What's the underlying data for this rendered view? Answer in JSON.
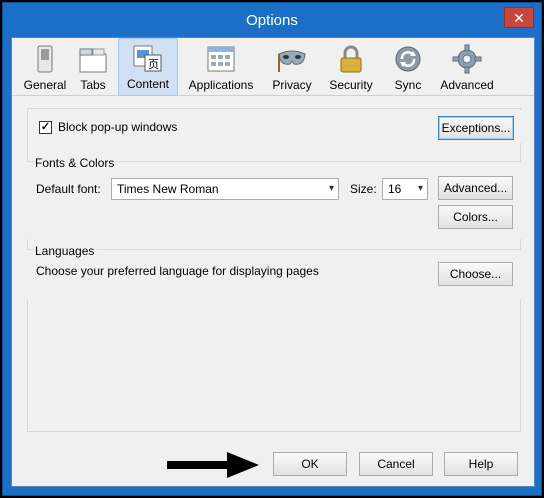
{
  "window": {
    "title": "Options",
    "close_glyph": "✕"
  },
  "toolbar": {
    "items": [
      {
        "label": "General",
        "icon": "switch-icon"
      },
      {
        "label": "Tabs",
        "icon": "tabs-icon"
      },
      {
        "label": "Content",
        "icon": "content-icon",
        "active": true
      },
      {
        "label": "Applications",
        "icon": "applications-icon"
      },
      {
        "label": "Privacy",
        "icon": "mask-icon"
      },
      {
        "label": "Security",
        "icon": "lock-icon"
      },
      {
        "label": "Sync",
        "icon": "sync-icon"
      },
      {
        "label": "Advanced",
        "icon": "gear-icon"
      }
    ]
  },
  "popup": {
    "label": "Block pop-up windows",
    "checked": true,
    "exceptions_button": "Exceptions..."
  },
  "fonts": {
    "group_title": "Fonts & Colors",
    "default_font_label": "Default font:",
    "default_font_value": "Times New Roman",
    "size_label": "Size:",
    "size_value": "16",
    "advanced_button": "Advanced...",
    "colors_button": "Colors..."
  },
  "languages": {
    "group_title": "Languages",
    "description": "Choose your preferred language for displaying pages",
    "choose_button": "Choose..."
  },
  "footer": {
    "ok_button": "OK",
    "cancel_button": "Cancel",
    "help_button": "Help"
  },
  "colors": {
    "titlebar": "#1c6fc6",
    "close": "#c9463d",
    "active_tab": "#cfe1f3"
  }
}
